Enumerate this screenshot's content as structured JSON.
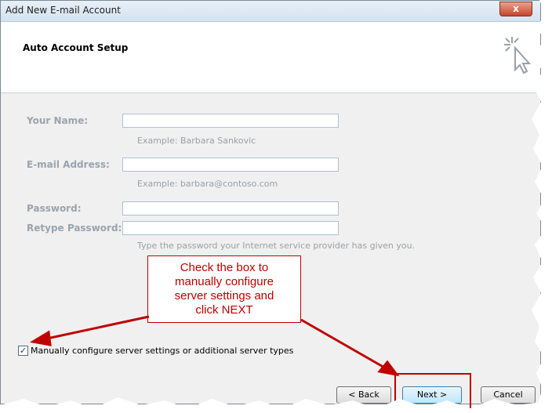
{
  "window": {
    "title": "Add New E-mail Account",
    "close_symbol": "x"
  },
  "header": {
    "title": "Auto Account Setup",
    "icon": "cursor-sparkle-icon"
  },
  "form": {
    "name_label": "Your Name:",
    "name_value": "",
    "name_hint": "Example: Barbara Sankovic",
    "email_label": "E-mail Address:",
    "email_value": "",
    "email_hint": "Example: barbara@contoso.com",
    "password_label": "Password:",
    "password_value": "",
    "retype_label": "Retype Password:",
    "retype_value": "",
    "password_hint": "Type the password your Internet service provider has given you."
  },
  "manual": {
    "checked": true,
    "checkmark": "✓",
    "label": "Manually configure server settings or additional server types"
  },
  "callout": {
    "lines": [
      "Check the box to",
      "manually configure",
      "server settings and",
      "click NEXT"
    ],
    "color": "#c00000"
  },
  "buttons": {
    "back": "< Back",
    "next": "Next >",
    "cancel": "Cancel"
  }
}
